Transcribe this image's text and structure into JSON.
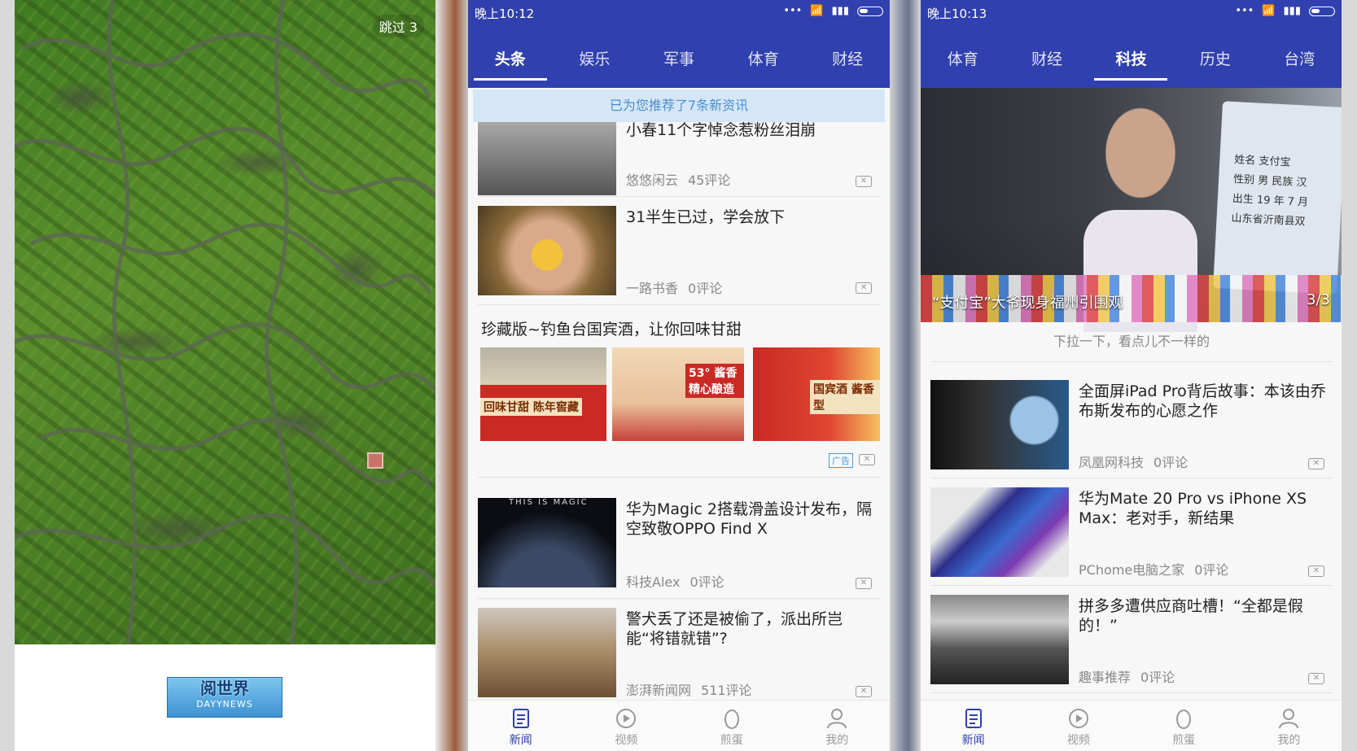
{
  "splash": {
    "skip_label": "跳过 3",
    "logo_main": "阅世界",
    "logo_sub": "DAYYNEWS"
  },
  "screen2": {
    "status_time": "晚上10:12",
    "tabs": [
      "头条",
      "娱乐",
      "军事",
      "体育",
      "财经"
    ],
    "active_tab": "头条",
    "toast": "已为您推荐了7条新资讯",
    "articles": [
      {
        "title": "小春11个字悼念惹粉丝泪崩",
        "source": "悠悠闲云",
        "comments": "45评论"
      },
      {
        "title": "31半生已过，学会放下",
        "source": "一路书香",
        "comments": "0评论"
      },
      {
        "title": "华为Magic 2搭载滑盖设计发布，隔空致敬OPPO Find X",
        "source": "科技Alex",
        "comments": "0评论"
      },
      {
        "title": "警犬丢了还是被偷了，派出所岂能“将错就错”?",
        "source": "澎湃新闻网",
        "comments": "511评论"
      }
    ],
    "ad": {
      "title": "珍藏版~钓鱼台国宾酒，让你回味甘甜",
      "labels": [
        "回味甘甜 陈年窖藏",
        "53° 酱香 精心酿造",
        "国宾酒 酱香型"
      ],
      "badge": "广告"
    },
    "magic_caption": "THIS IS MAGIC"
  },
  "screen3": {
    "status_time": "晚上10:13",
    "tabs": [
      "体育",
      "财经",
      "科技",
      "历史",
      "台湾"
    ],
    "active_tab": "科技",
    "hero_caption": "“支付宝”大爷现身福州引围观",
    "hero_count": "3/3",
    "card_text": [
      "姓名  支付宝",
      "性别  男   民族 汉",
      "出生  19  年  7  月",
      "山东省沂南县双"
    ],
    "pull_hint": "下拉一下，看点儿不一样的",
    "articles": [
      {
        "title": "全面屏iPad Pro背后故事：本该由乔布斯发布的心愿之作",
        "source": "凤凰网科技",
        "comments": "0评论"
      },
      {
        "title": "华为Mate 20 Pro vs iPhone XS Max：老对手，新结果",
        "source": "PChome电脑之家",
        "comments": "0评论"
      },
      {
        "title": "拼多多遭供应商吐槽！“全都是假的！”",
        "source": "趣事推荐",
        "comments": "0评论"
      }
    ]
  },
  "bottom_nav": [
    "新闻",
    "视频",
    "煎蛋",
    "我的"
  ],
  "colors": {
    "primary": "#3040ae",
    "toast_bg": "#d5e7f6",
    "toast_text": "#4a8ed0"
  }
}
